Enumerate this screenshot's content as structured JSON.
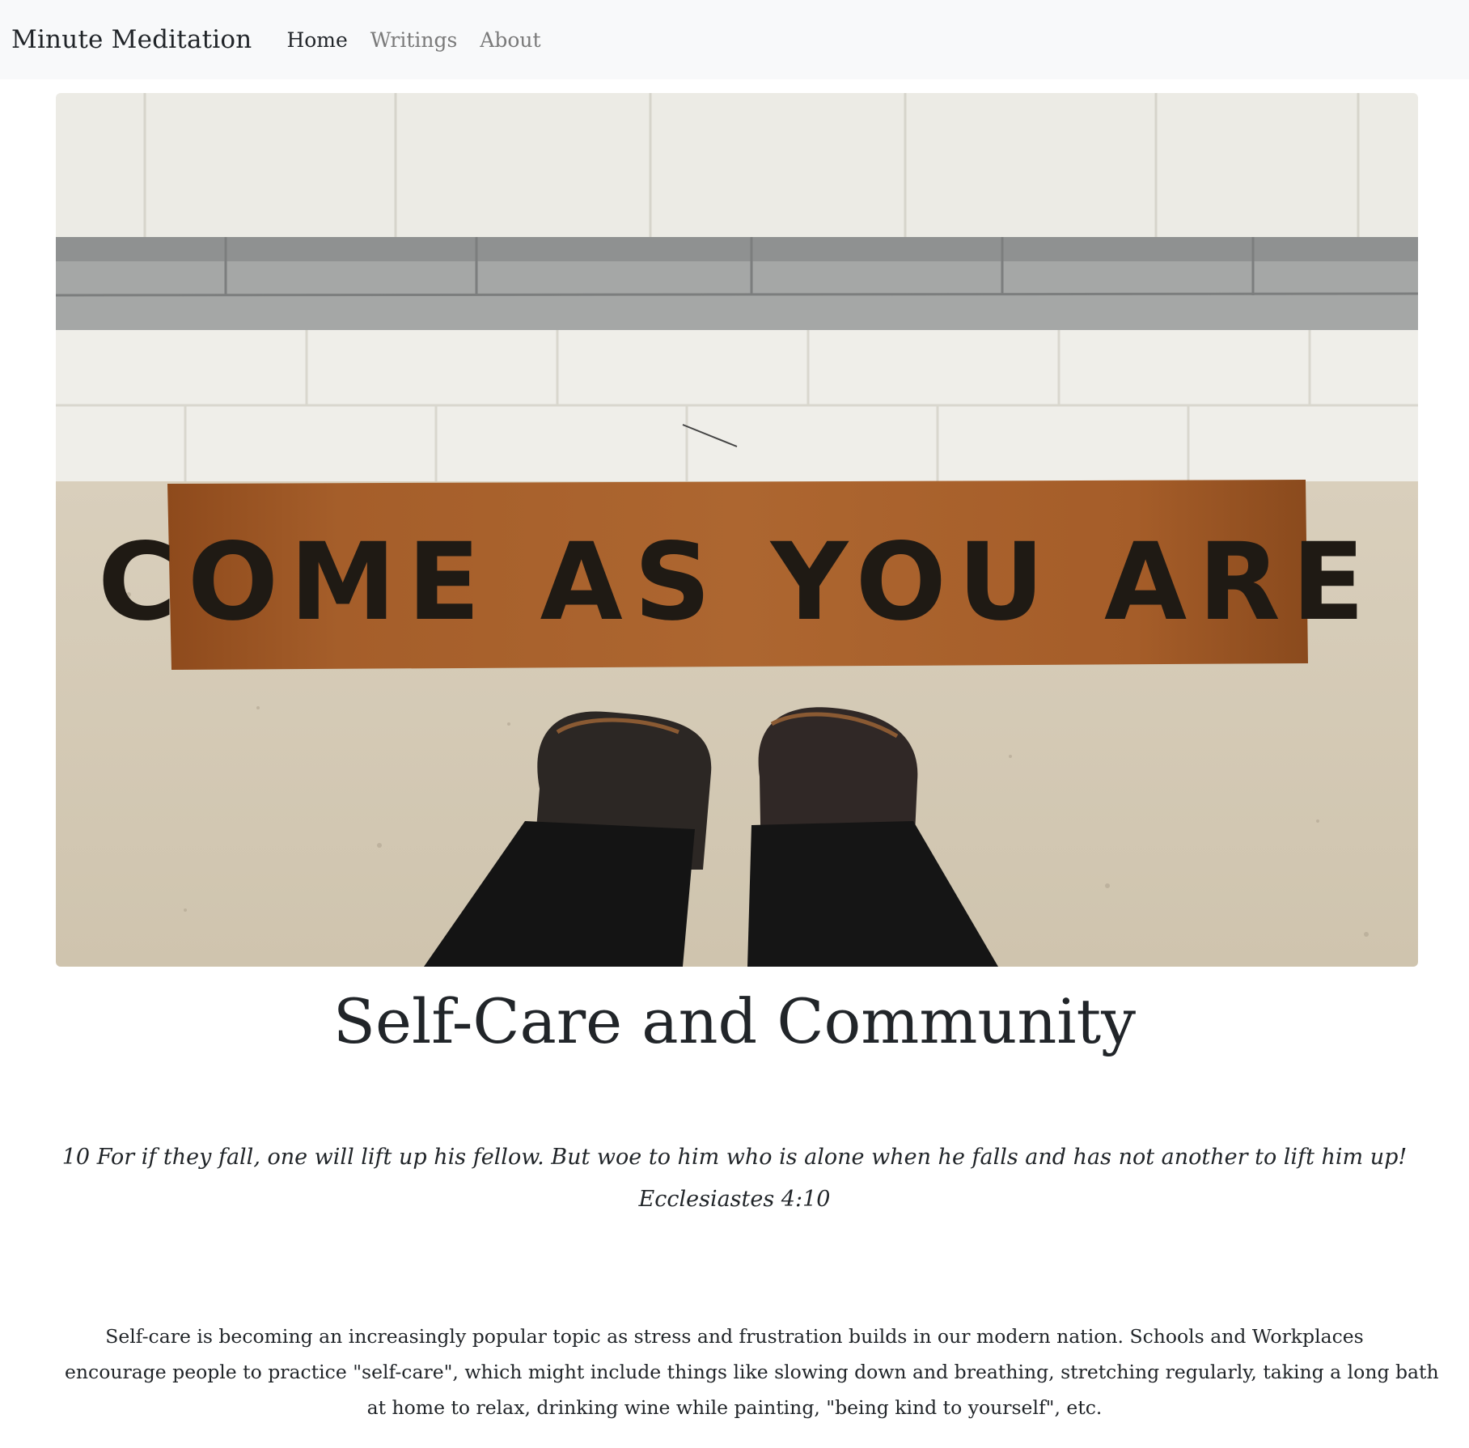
{
  "navbar": {
    "brand": "Minute Meditation",
    "links": [
      {
        "label": "Home",
        "active": true
      },
      {
        "label": "Writings",
        "active": false
      },
      {
        "label": "About",
        "active": false
      }
    ]
  },
  "hero": {
    "doormat_text": "COME AS YOU ARE"
  },
  "article": {
    "title": "Self-Care and Community",
    "verse": {
      "text": "10 For if they fall, one will lift up his fellow. But woe to him who is alone when he falls and has not another to lift him up!",
      "reference": "Ecclesiastes 4:10"
    },
    "paragraph_lines": [
      "Self-care is becoming an increasingly popular topic as stress and frustration builds in our modern nation. Schools and Workplaces",
      "encourage people to practice \"self-care\", which might include things like slowing down and breathing, stretching regularly, taking a long bath",
      "at home to relax, drinking wine while painting, \"being kind to yourself\", etc."
    ]
  }
}
